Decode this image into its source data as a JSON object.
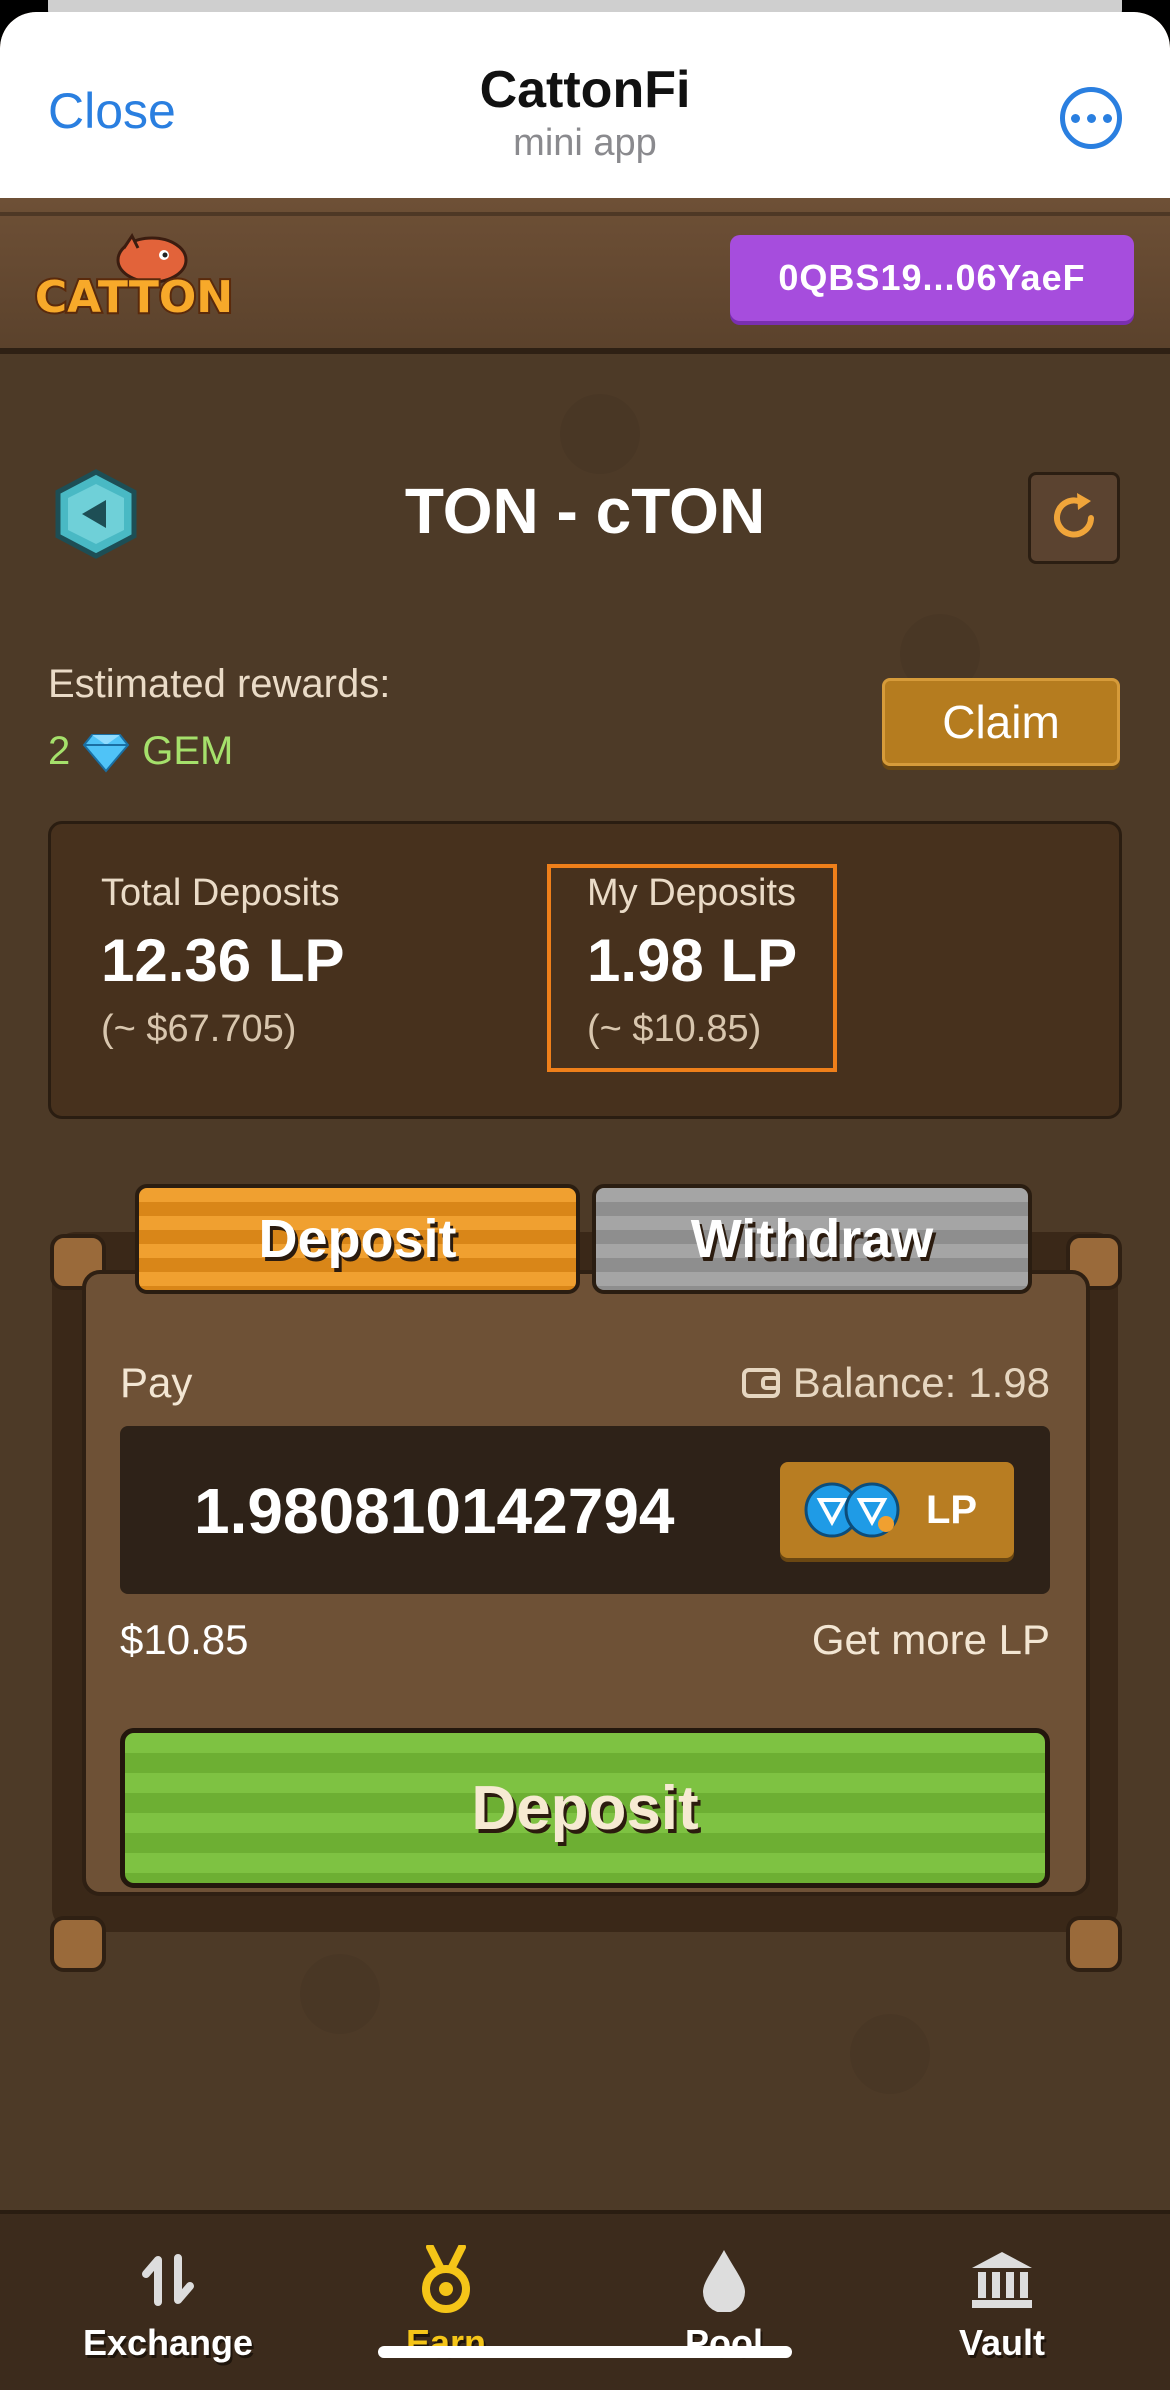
{
  "telegram": {
    "close_label": "Close",
    "title": "CattonFi",
    "subtitle": "mini app",
    "more_icon": "ellipsis-circle-icon"
  },
  "app_bar": {
    "logo_text": "CATTON",
    "wallet_address": "0QBS19...06YaeF"
  },
  "pool": {
    "title": "TON - cTON",
    "rewards_label": "Estimated rewards:",
    "rewards_amount": "2",
    "rewards_token": "GEM",
    "claim_label": "Claim"
  },
  "stats": {
    "total_label": "Total Deposits",
    "total_value": "12.36 LP",
    "total_usd": "(~ $67.705)",
    "my_label": "My Deposits",
    "my_value": "1.98 LP",
    "my_usd": "(~ $10.85)"
  },
  "tabs": {
    "deposit": "Deposit",
    "withdraw": "Withdraw",
    "active": "Deposit"
  },
  "form": {
    "pay_label": "Pay",
    "balance_label": "Balance:",
    "balance_value": "1.98",
    "amount_value": "1.980810142794",
    "token_label": "LP",
    "usd_value": "$10.85",
    "get_more_label": "Get more LP",
    "submit_label": "Deposit"
  },
  "nav": {
    "items": [
      {
        "label": "Exchange",
        "icon": "swap-arrows-icon",
        "active": false
      },
      {
        "label": "Earn",
        "icon": "medal-icon",
        "active": true
      },
      {
        "label": "Pool",
        "icon": "drop-icon",
        "active": false
      },
      {
        "label": "Vault",
        "icon": "bank-icon",
        "active": false
      }
    ]
  },
  "colors": {
    "accent_blue": "#2a7fe0",
    "wallet_purple": "#a64ddd",
    "reward_green": "#a5e06b",
    "highlight_orange": "#ef7f1a",
    "deposit_green": "#74b93a",
    "nav_active": "#f5c518"
  }
}
